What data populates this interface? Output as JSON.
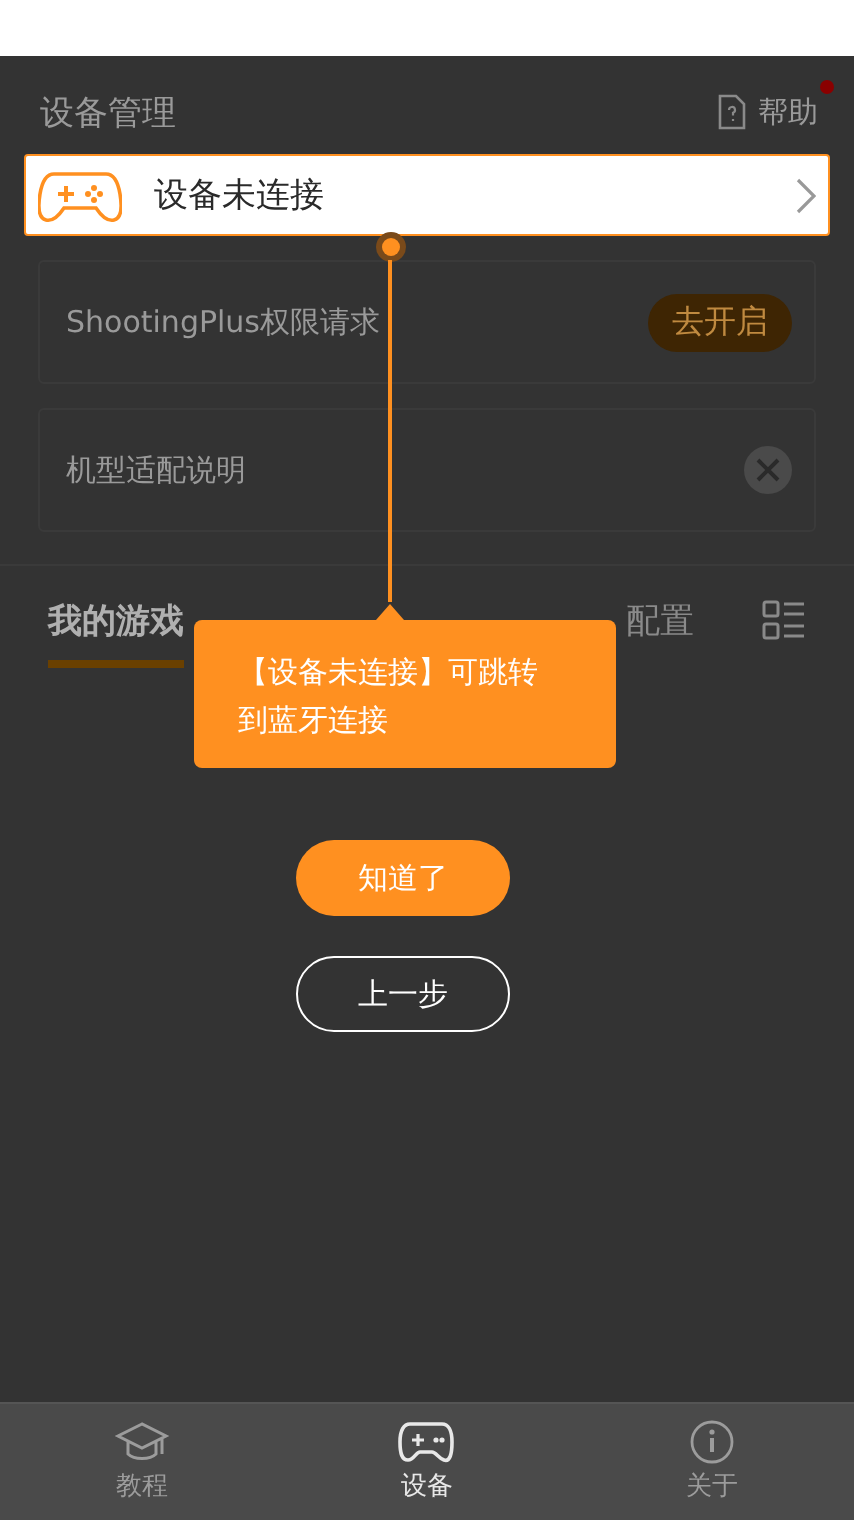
{
  "header": {
    "title": "设备管理",
    "help": "帮助",
    "help_badge": true
  },
  "device": {
    "status": "设备未连接"
  },
  "cards": [
    {
      "kind": "action",
      "label": "ShootingPlus权限请求",
      "button": "去开启"
    },
    {
      "kind": "dismiss",
      "label": "机型适配说明"
    }
  ],
  "tabs": [
    {
      "label": "我的游戏",
      "selected": true
    },
    {
      "label": "配置",
      "selected": false
    }
  ],
  "guide": {
    "text": "【设备未连接】可跳转到蓝牙连接",
    "confirm": "知道了",
    "back": "上一步"
  },
  "bottom_nav": [
    {
      "kind": "cap",
      "label": "教程",
      "selected": false
    },
    {
      "kind": "gamepad",
      "label": "设备",
      "selected": true
    },
    {
      "kind": "info",
      "label": "关于",
      "selected": false
    }
  ]
}
